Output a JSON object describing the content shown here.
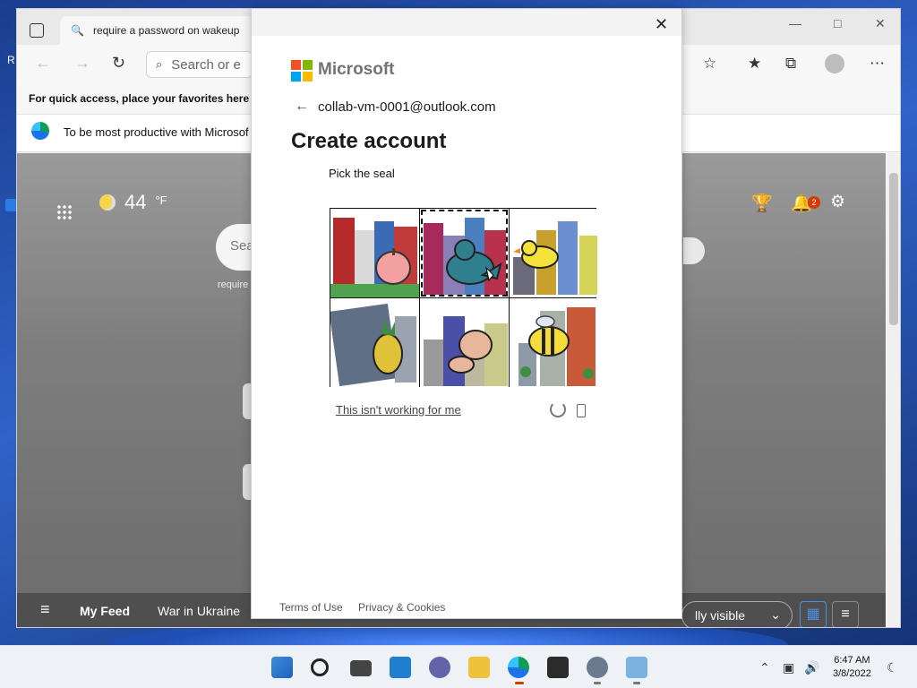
{
  "browser": {
    "tab_title": "require a password on wakeup",
    "address_placeholder": "Search or e",
    "favorites_hint": "For quick access, place your favorites here on",
    "info_text": "To be most productive with Microsof",
    "weather_temp": "44",
    "weather_unit": "°F",
    "search_partial": "Sea",
    "search_hint": "require",
    "notification_count": "2",
    "feed": {
      "my_feed": "My Feed",
      "war": "War in Ukraine",
      "visibility": "lly visible"
    }
  },
  "dialog": {
    "brand": "Microsoft",
    "email": "collab-vm-0001@outlook.com",
    "title": "Create account",
    "prompt": "Pick the seal",
    "help_link": "This isn't working for me",
    "footer": {
      "terms": "Terms of Use",
      "privacy": "Privacy & Cookies"
    },
    "captcha": {
      "cells": [
        {
          "subject": "apple",
          "selected": false
        },
        {
          "subject": "seal",
          "selected": true
        },
        {
          "subject": "duck",
          "selected": false
        },
        {
          "subject": "pineapple",
          "selected": false
        },
        {
          "subject": "pig",
          "selected": false
        },
        {
          "subject": "bee",
          "selected": false
        }
      ]
    }
  },
  "taskbar": {
    "time": "6:47 AM",
    "date": "3/8/2022"
  },
  "colors": {
    "ms_red": "#f25022",
    "ms_green": "#7fba00",
    "ms_blue": "#00a4ef",
    "ms_yellow": "#ffb900"
  }
}
